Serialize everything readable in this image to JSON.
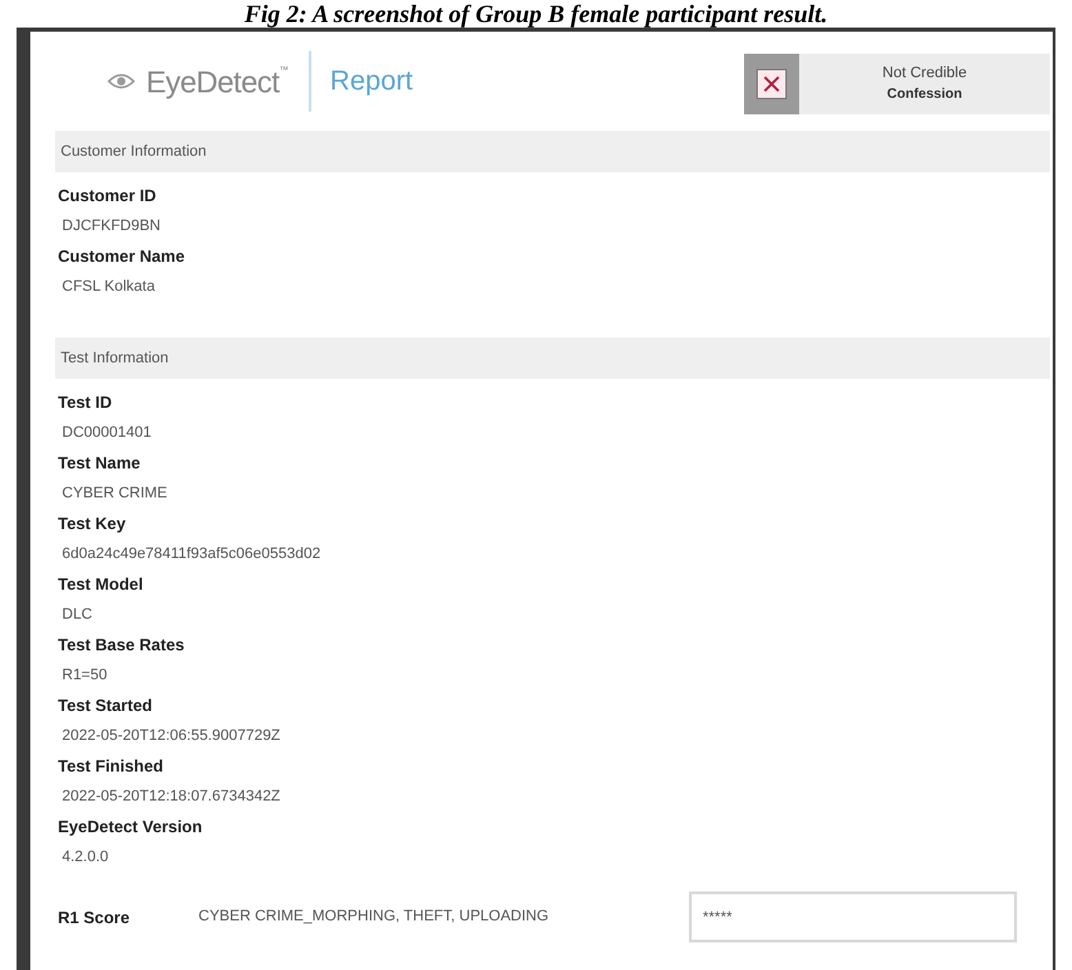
{
  "caption": "Fig 2: A screenshot of Group B female participant result.",
  "header": {
    "brand": "EyeDetect",
    "trademark": "™",
    "title": "Report",
    "verdict": {
      "kind": "not_credible",
      "result": "Not Credible",
      "type": "Confession"
    }
  },
  "sections": [
    {
      "title": "Customer Information",
      "fields": [
        {
          "label": "Customer ID",
          "value": "DJCFKFD9BN"
        },
        {
          "label": "Customer Name",
          "value": "CFSL Kolkata"
        }
      ]
    },
    {
      "title": "Test Information",
      "fields": [
        {
          "label": "Test ID",
          "value": "DC00001401"
        },
        {
          "label": "Test Name",
          "value": "CYBER CRIME"
        },
        {
          "label": "Test Key",
          "value": "6d0a24c49e78411f93af5c06e0553d02"
        },
        {
          "label": "Test Model",
          "value": "DLC"
        },
        {
          "label": "Test Base Rates",
          "value": "R1=50"
        },
        {
          "label": "Test Started",
          "value": "2022-05-20T12:06:55.9007729Z"
        },
        {
          "label": "Test Finished",
          "value": "2022-05-20T12:18:07.6734342Z"
        },
        {
          "label": "EyeDetect Version",
          "value": "4.2.0.0"
        }
      ]
    }
  ],
  "score": {
    "label": "R1 Score",
    "topics": "CYBER CRIME_MORPHING, THEFT, UPLOADING",
    "value": "*****"
  }
}
